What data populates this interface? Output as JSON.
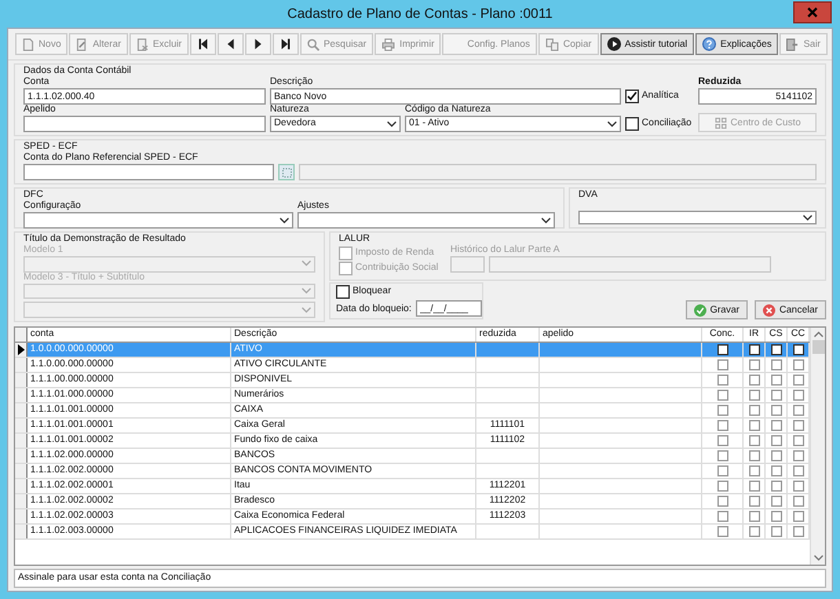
{
  "window": {
    "title": "Cadastro de Plano de Contas - Plano :0011"
  },
  "toolbar": [
    {
      "label": "Novo",
      "kind": "new",
      "disabled": true
    },
    {
      "label": "Alterar",
      "kind": "edit",
      "disabled": true
    },
    {
      "label": "Excluir",
      "kind": "delete",
      "disabled": true
    },
    {
      "kind": "first",
      "disabled": false
    },
    {
      "kind": "prev",
      "disabled": false
    },
    {
      "kind": "next",
      "disabled": false
    },
    {
      "kind": "last",
      "disabled": false
    },
    {
      "label": "Pesquisar",
      "kind": "search",
      "disabled": true
    },
    {
      "label": "Imprimir",
      "kind": "print",
      "disabled": true
    },
    {
      "label": "Config. Planos",
      "kind": "text",
      "disabled": true
    },
    {
      "label": "Copiar",
      "kind": "copy",
      "disabled": true
    },
    {
      "label": "Assistir tutorial",
      "kind": "play",
      "disabled": false
    },
    {
      "label": "Explicações",
      "kind": "help",
      "disabled": false
    },
    {
      "label": "Sair",
      "kind": "exit",
      "disabled": true
    }
  ],
  "conta_contabil": {
    "legend": "Dados da Conta Contábil",
    "conta": {
      "label": "Conta",
      "value": "1.1.1.02.000.40"
    },
    "descricao": {
      "label": "Descrição",
      "value": "Banco Novo"
    },
    "analitica": {
      "label": "Analítica",
      "checked": true
    },
    "reduzida": {
      "label": "Reduzida",
      "value": "5141102"
    },
    "apelido": {
      "label": "Apelido"
    },
    "natureza": {
      "label": "Natureza",
      "value": "Devedora"
    },
    "codigo_natureza": {
      "label": "Código da Natureza",
      "value": "01 - Ativo"
    },
    "conciliacao": {
      "label": "Conciliação",
      "checked": false
    },
    "centro_custo": {
      "label": "Centro de Custo",
      "disabled": true
    }
  },
  "sped": {
    "legend": "SPED - ECF",
    "label": "Conta do Plano Referencial SPED - ECF"
  },
  "dfc": {
    "legend": "DFC",
    "configuracao": {
      "label": "Configuração"
    },
    "ajustes": {
      "label": "Ajustes"
    }
  },
  "dva": {
    "legend": "DVA"
  },
  "titulo_dre": {
    "legend": "Título da Demonstração de Resultado",
    "disabled": true,
    "modelo1": {
      "label": "Modelo 1"
    },
    "modelo3": {
      "label": "Modelo 3 - Título + Subtítulo"
    }
  },
  "lalur": {
    "legend": "LALUR",
    "imposto_renda": {
      "label": "Imposto de Renda",
      "checked": false,
      "disabled": true
    },
    "contribuicao_social": {
      "label": "Contribuição Social",
      "checked": false,
      "disabled": true
    },
    "historico_label": "Histórico do Lalur Parte A"
  },
  "bloqueio": {
    "bloquear": {
      "label": "Bloquear",
      "checked": false
    },
    "data_label": "Data do bloqueio:",
    "data_value": "__/__/____"
  },
  "buttons": [
    {
      "label": "Gravar",
      "kind": "ok"
    },
    {
      "label": "Cancelar",
      "kind": "cancel"
    }
  ],
  "table": {
    "columns": [
      "conta",
      "Descrição",
      "reduzida",
      "apelido",
      "Conc.",
      "IR",
      "CS",
      "CC"
    ],
    "rows": [
      {
        "conta": "1.0.0.00.000.00000",
        "descricao": "ATIVO",
        "selected": true,
        "conc": false,
        "ir": false,
        "cs": false,
        "cc": false
      },
      {
        "conta": "1.1.0.00.000.00000",
        "descricao": "ATIVO CIRCULANTE",
        "selected": false,
        "conc": false,
        "ir": false,
        "cs": false,
        "cc": false
      },
      {
        "conta": "1.1.1.00.000.00000",
        "descricao": "DISPONIVEL",
        "selected": false,
        "conc": false,
        "ir": false,
        "cs": false,
        "cc": false
      },
      {
        "conta": "1.1.1.01.000.00000",
        "descricao": "Numerários",
        "selected": false,
        "conc": false,
        "ir": false,
        "cs": false,
        "cc": false
      },
      {
        "conta": "1.1.1.01.001.00000",
        "descricao": "CAIXA",
        "selected": false,
        "conc": false,
        "ir": false,
        "cs": false,
        "cc": false
      },
      {
        "conta": "1.1.1.01.001.00001",
        "descricao": "Caixa Geral",
        "reduzida": "1111101",
        "selected": false,
        "conc": false,
        "ir": false,
        "cs": false,
        "cc": false
      },
      {
        "conta": "1.1.1.01.001.00002",
        "descricao": "Fundo fixo de caixa",
        "reduzida": "1111102",
        "selected": false,
        "conc": false,
        "ir": false,
        "cs": false,
        "cc": false
      },
      {
        "conta": "1.1.1.02.000.00000",
        "descricao": "BANCOS",
        "selected": false,
        "conc": false,
        "ir": false,
        "cs": false,
        "cc": false
      },
      {
        "conta": "1.1.1.02.002.00000",
        "descricao": "BANCOS CONTA MOVIMENTO",
        "selected": false,
        "conc": false,
        "ir": false,
        "cs": false,
        "cc": false
      },
      {
        "conta": "1.1.1.02.002.00001",
        "descricao": "Itau",
        "reduzida": "1112201",
        "selected": false,
        "conc": false,
        "ir": false,
        "cs": false,
        "cc": false
      },
      {
        "conta": "1.1.1.02.002.00002",
        "descricao": "Bradesco",
        "reduzida": "1112202",
        "selected": false,
        "conc": false,
        "ir": false,
        "cs": false,
        "cc": false
      },
      {
        "conta": "1.1.1.02.002.00003",
        "descricao": "Caixa Economica Federal",
        "reduzida": "1112203",
        "selected": false,
        "conc": false,
        "ir": false,
        "cs": false,
        "cc": false
      },
      {
        "conta": "1.1.1.02.003.00000",
        "descricao": "APLICACOES FINANCEIRAS LIQUIDEZ IMEDIATA",
        "selected": false,
        "conc": false,
        "ir": false,
        "cs": false,
        "cc": false
      }
    ]
  },
  "status_bar": "Assinale para usar esta conta na Conciliação"
}
